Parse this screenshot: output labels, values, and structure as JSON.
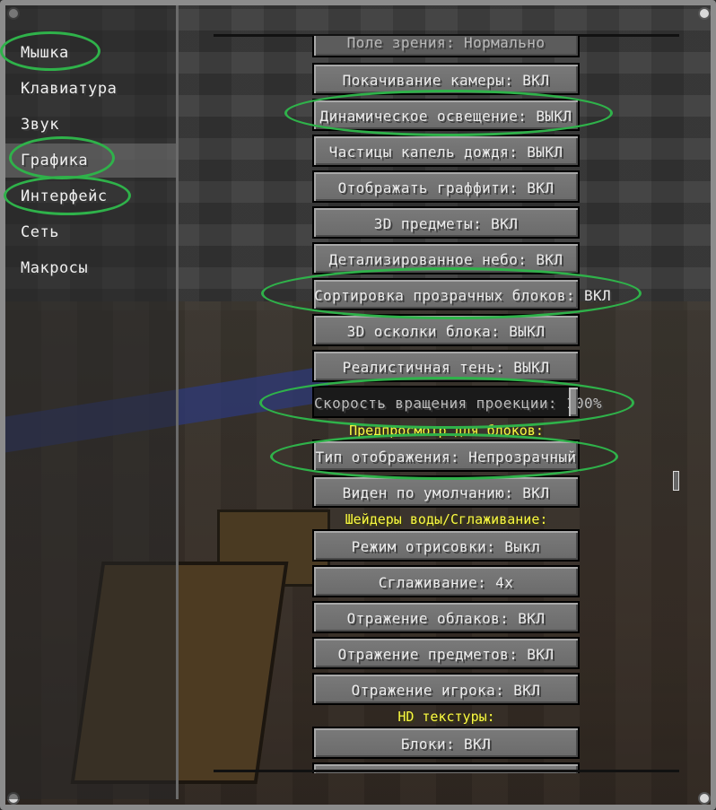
{
  "sidebar": {
    "items": [
      {
        "label": "Мышка"
      },
      {
        "label": "Клавиатура"
      },
      {
        "label": "Звук"
      },
      {
        "label": "Графика"
      },
      {
        "label": "Интерфейс"
      },
      {
        "label": "Сеть"
      },
      {
        "label": "Макросы"
      }
    ],
    "selected_index": 3
  },
  "settings": {
    "field_of_view": "Поле зрения: Нормально",
    "view_bobbing": "Покачивание камеры: ВКЛ",
    "dynamic_lighting": "Динамическое освещение: ВЫКЛ",
    "rain_particles": "Частицы капель дождя: ВЫКЛ",
    "graffiti": "Отображать граффити: ВКЛ",
    "items_3d": "3D предметы: ВКЛ",
    "detailed_sky": "Детализированное небо: ВКЛ",
    "transparent_sorting": "Сортировка прозрачных блоков: ВКЛ",
    "block_fragments": "3D осколки блока: ВЫКЛ",
    "realistic_shadow": "Реалистичная тень: ВЫКЛ",
    "projection_speed": "Скорость вращения проекции: 100%",
    "projection_speed_value": 100,
    "block_preview_header": "Предпросмотр для блоков:",
    "display_type": "Тип отображения: Непрозрачный",
    "visible_default": "Виден по умолчанию: ВКЛ",
    "water_shaders_header": "Шейдеры воды/Сглаживание:",
    "render_mode": "Режим отрисовки: Выкл",
    "antialiasing": "Сглаживание: 4x",
    "cloud_reflection": "Отражение облаков: ВКЛ",
    "item_reflection": "Отражение предметов: ВКЛ",
    "player_reflection": "Отражение игрока: ВКЛ",
    "hd_textures_header": "HD текстуры:",
    "blocks": "Блоки: ВКЛ"
  },
  "colors": {
    "highlight_ellipse": "#2fb24a",
    "section_header": "#fafa40",
    "button_face": "#707070"
  }
}
